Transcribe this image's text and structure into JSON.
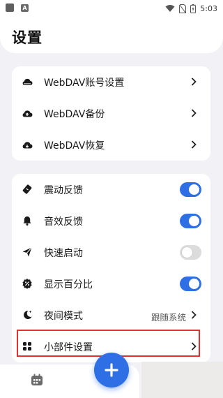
{
  "status_bar": {
    "time": "5:03"
  },
  "header": {
    "title": "设置"
  },
  "backup_card": {
    "items": [
      {
        "label": "WebDAV账号设置",
        "icon": "cloud-icon"
      },
      {
        "label": "WebDAV备份",
        "icon": "cloud-upload-icon"
      },
      {
        "label": "WebDAV恢复",
        "icon": "cloud-download-icon"
      }
    ]
  },
  "prefs_card": {
    "items": [
      {
        "label": "震动反馈",
        "icon": "vibration-icon",
        "toggle": true
      },
      {
        "label": "音效反馈",
        "icon": "bell-icon",
        "toggle": true
      },
      {
        "label": "快速启动",
        "icon": "send-icon",
        "toggle": false
      },
      {
        "label": "显示百分比",
        "icon": "percent-icon",
        "toggle": true
      },
      {
        "label": "夜间模式",
        "icon": "moon-icon",
        "value": "跟随系统"
      },
      {
        "label": "小部件设置",
        "icon": "widgets-icon"
      }
    ]
  },
  "colors": {
    "accent": "#2f6fe6",
    "highlight_border": "#e03030"
  },
  "bottom_nav": {
    "calendar_icon": "calendar-icon",
    "fab_icon": "plus-icon"
  }
}
